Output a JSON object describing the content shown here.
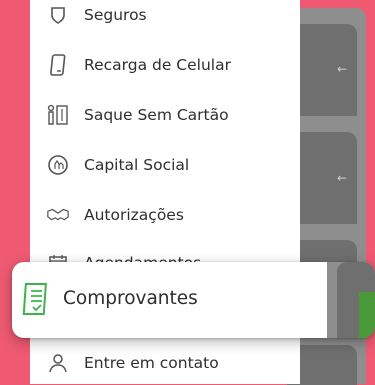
{
  "menu": {
    "items": [
      {
        "label": "Seguros",
        "icon": "shield-icon"
      },
      {
        "label": "Recarga de Celular",
        "icon": "phone-icon"
      },
      {
        "label": "Saque Sem Cartão",
        "icon": "atm-withdraw-icon"
      },
      {
        "label": "Capital Social",
        "icon": "capital-icon"
      },
      {
        "label": "Autorizações",
        "icon": "handshake-icon"
      },
      {
        "label": "Agendamentos",
        "icon": "calendar-icon"
      },
      {
        "label": "Entre em contato",
        "icon": "contact-icon"
      }
    ],
    "highlighted": {
      "label": "Comprovantes",
      "icon": "receipt-icon"
    }
  },
  "colors": {
    "background": "#ef5a72",
    "highlight_icon": "#3cb44b",
    "overlay_panel": "#8e8e8e"
  },
  "background_arrows": [
    "←",
    "←"
  ]
}
